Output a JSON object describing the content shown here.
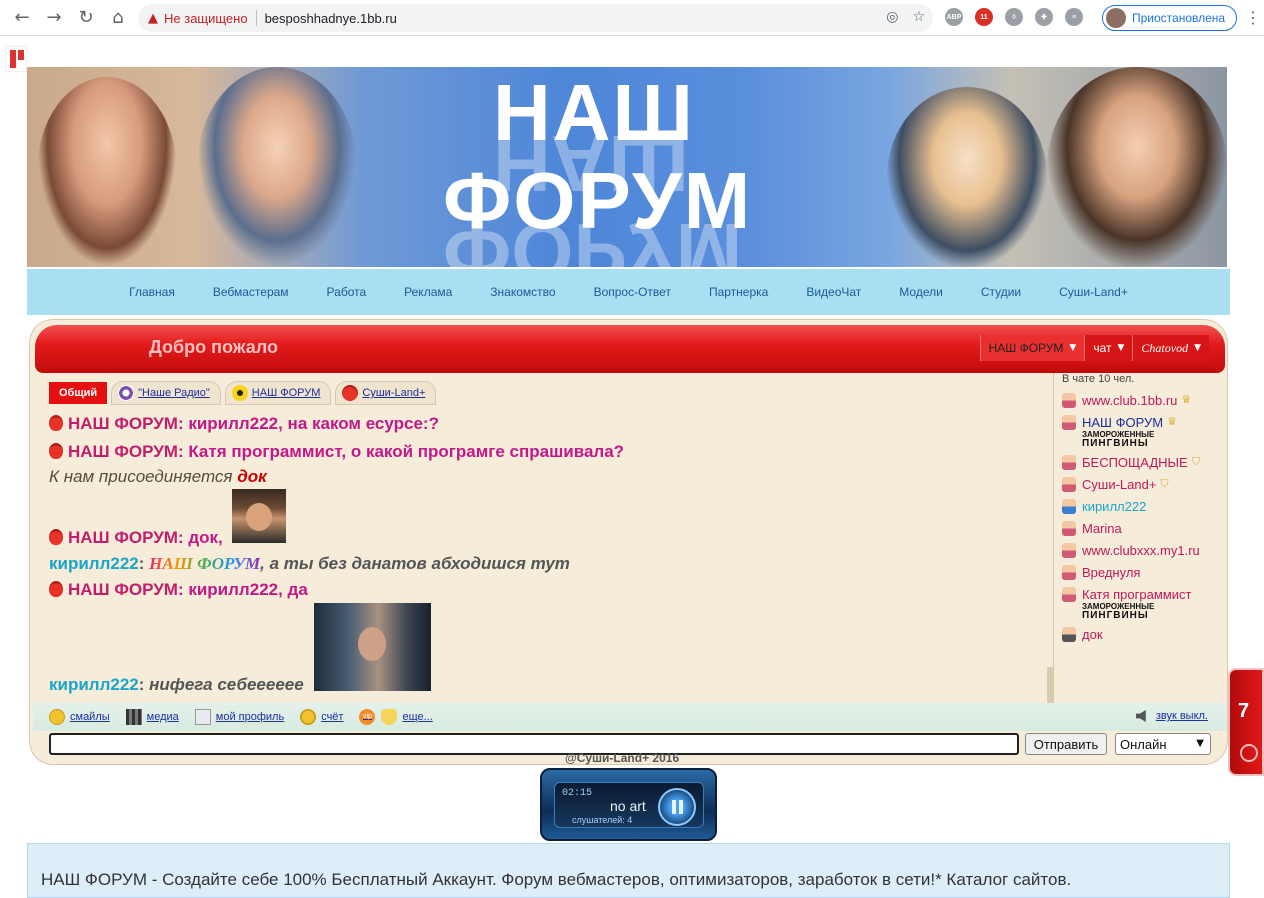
{
  "browser": {
    "security_label": "Не защищено",
    "url": "besposhhadnye.1bb.ru",
    "profile_label": "Приостановлена",
    "ext_badge": "11"
  },
  "banner": {
    "title_line1": "НАШ",
    "title_line2": "ФОРУМ"
  },
  "nav": {
    "items": [
      "Главная",
      "Вебмастерам",
      "Работа",
      "Реклама",
      "Знакомство",
      "Вопрос-Ответ",
      "Партнерка",
      "ВидеоЧат",
      "Модели",
      "Студии",
      "Суши-Land+"
    ]
  },
  "chat": {
    "welcome": "Добро пожало",
    "rooms": [
      "НАШ ФОРУМ",
      "чат",
      "Chatovod"
    ],
    "tabs": {
      "main": "Общий",
      "items": [
        "\"Наше Радио\"",
        "НАШ ФОРУМ",
        "Суши-Land+"
      ]
    },
    "messages": [
      {
        "nick": "НАШ ФОРУМ",
        "text": "кирилл222, на каком есурсе:?"
      },
      {
        "nick": "НАШ ФОРУМ",
        "text": "Катя программист, о какой програмге спрашивала?"
      },
      {
        "system_prefix": "К нам присоединяется",
        "who": "док"
      },
      {
        "nick": "НАШ ФОРУМ",
        "text": "док,"
      },
      {
        "nick": "кирилл222",
        "rainbow": "НАШ ФОРУМ",
        "text": ", а ты без данатов абходишся тут"
      },
      {
        "nick": "НАШ ФОРУМ",
        "text": "кирилл222, да"
      },
      {
        "nick": "кирилл222",
        "text": "нифега себееееее"
      }
    ],
    "users_count": "В чате 10 чел.",
    "users": [
      {
        "name": "www.club.1bb.ru",
        "badge": "♛"
      },
      {
        "name": "НАШ ФОРУМ",
        "badge": "♛",
        "sub_top": "ЗАМОРОЖЕННЫЕ",
        "sub_bottom": "ПИНГВИНЫ"
      },
      {
        "name": "БЕСПОЩАДНЫЕ",
        "badge": "⛉"
      },
      {
        "name": "Суши-Land+",
        "badge": "⛉"
      },
      {
        "name": "кирилл222"
      },
      {
        "name": "Marina"
      },
      {
        "name": "www.clubxxx.my1.ru"
      },
      {
        "name": "Вреднуля"
      },
      {
        "name": "Катя программист",
        "sub_top": "ЗАМОРОЖЕННЫЕ",
        "sub_bottom": "ПИНГВИНЫ"
      },
      {
        "name": "док"
      }
    ],
    "toolbar": {
      "smiles": "смайлы",
      "media": "медиа",
      "profile": "мой профиль",
      "account": "счёт",
      "vip": "vip",
      "more": "еще...",
      "sound": "звук выкл."
    },
    "send_label": "Отправить",
    "status_value": "Онлайн",
    "copyright": "@Суши-Land+ 2016"
  },
  "side_tab": {
    "number": "7"
  },
  "radio": {
    "time": "02:15",
    "art": "no art",
    "listeners": "слушателей: 4"
  },
  "about": {
    "text": "НАШ ФОРУМ - Создайте себе 100% Бесплатный Аккаунт. Форум вебмастеров, оптимизаторов, заработок в сети!* Каталог сайтов."
  }
}
